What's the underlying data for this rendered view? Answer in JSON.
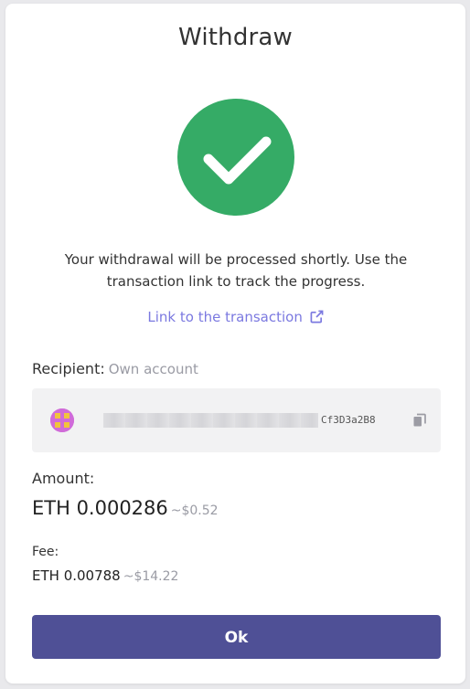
{
  "dialog": {
    "title": "Withdraw",
    "message": "Your withdrawal will be processed shortly. Use the transaction link to track the progress.",
    "tx_link_label": "Link to the transaction"
  },
  "recipient": {
    "label": "Recipient:",
    "type": "Own account",
    "address_visible_tail": "Cf3D3a2B8"
  },
  "amount": {
    "label": "Amount:",
    "value": "ETH 0.000286",
    "usd": "~$0.52"
  },
  "fee": {
    "label": "Fee:",
    "value": "ETH 0.00788",
    "usd": "~$14.22"
  },
  "actions": {
    "ok_label": "Ok"
  },
  "colors": {
    "success": "#35ab66",
    "link": "#7b79e0",
    "primary_button": "#4f5096"
  },
  "icons": [
    "check-icon",
    "external-link-icon",
    "identicon",
    "copy-icon"
  ]
}
